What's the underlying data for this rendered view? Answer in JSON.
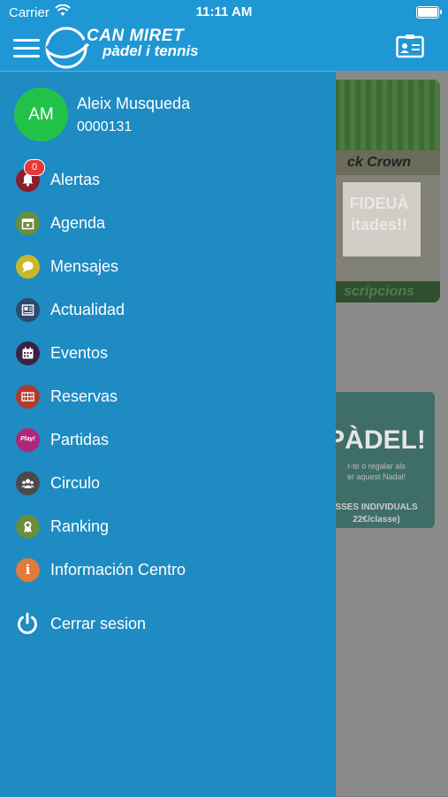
{
  "status_bar": {
    "carrier": "Carrier",
    "time": "11:11 AM"
  },
  "header": {
    "logo_line1": "CAN MIRET",
    "logo_line2": "pàdel i tennis"
  },
  "background": {
    "card1_banner": "ck Crown",
    "card1_promo_line1": "FIDEUÀ",
    "card1_promo_line2": "itades!!",
    "card1_footer": "scripcions",
    "card2_title": "PÀDEL!",
    "card2_sub_line1": "r-te o regalar als",
    "card2_sub_line2": "er aquest Nadal!",
    "card2_bottom_line1": "SSES INDIVIDUALS",
    "card2_bottom_line2": "22€/classe)"
  },
  "profile": {
    "initials": "AM",
    "name": "Aleix Musqueda",
    "id": "0000131"
  },
  "menu": [
    {
      "label": "Alertas",
      "icon": "bell-icon",
      "color": "#8b1d2c",
      "badge": "0"
    },
    {
      "label": "Agenda",
      "icon": "calendar-icon",
      "color": "#6b8e3a"
    },
    {
      "label": "Mensajes",
      "icon": "chat-icon",
      "color": "#c9b829"
    },
    {
      "label": "Actualidad",
      "icon": "newspaper-icon",
      "color": "#2e4a6b"
    },
    {
      "label": "Eventos",
      "icon": "event-calendar-icon",
      "color": "#3b2240"
    },
    {
      "label": "Reservas",
      "icon": "court-icon",
      "color": "#b23a2a"
    },
    {
      "label": "Partidas",
      "icon": "play-icon",
      "color": "#b0277a",
      "icon_text": "Play!"
    },
    {
      "label": "Circulo",
      "icon": "group-icon",
      "color": "#4a4a4a"
    },
    {
      "label": "Ranking",
      "icon": "medal-icon",
      "color": "#6b8e3a"
    },
    {
      "label": "Información Centro",
      "icon": "info-icon",
      "color": "#e07b39",
      "icon_text": "i"
    },
    {
      "label": "Cerrar sesion",
      "icon": "power-icon"
    }
  ],
  "colors": {
    "header": "#1f97d4",
    "drawer": "#1e8bc3",
    "avatar": "#22c24a",
    "badge": "#e53935"
  }
}
